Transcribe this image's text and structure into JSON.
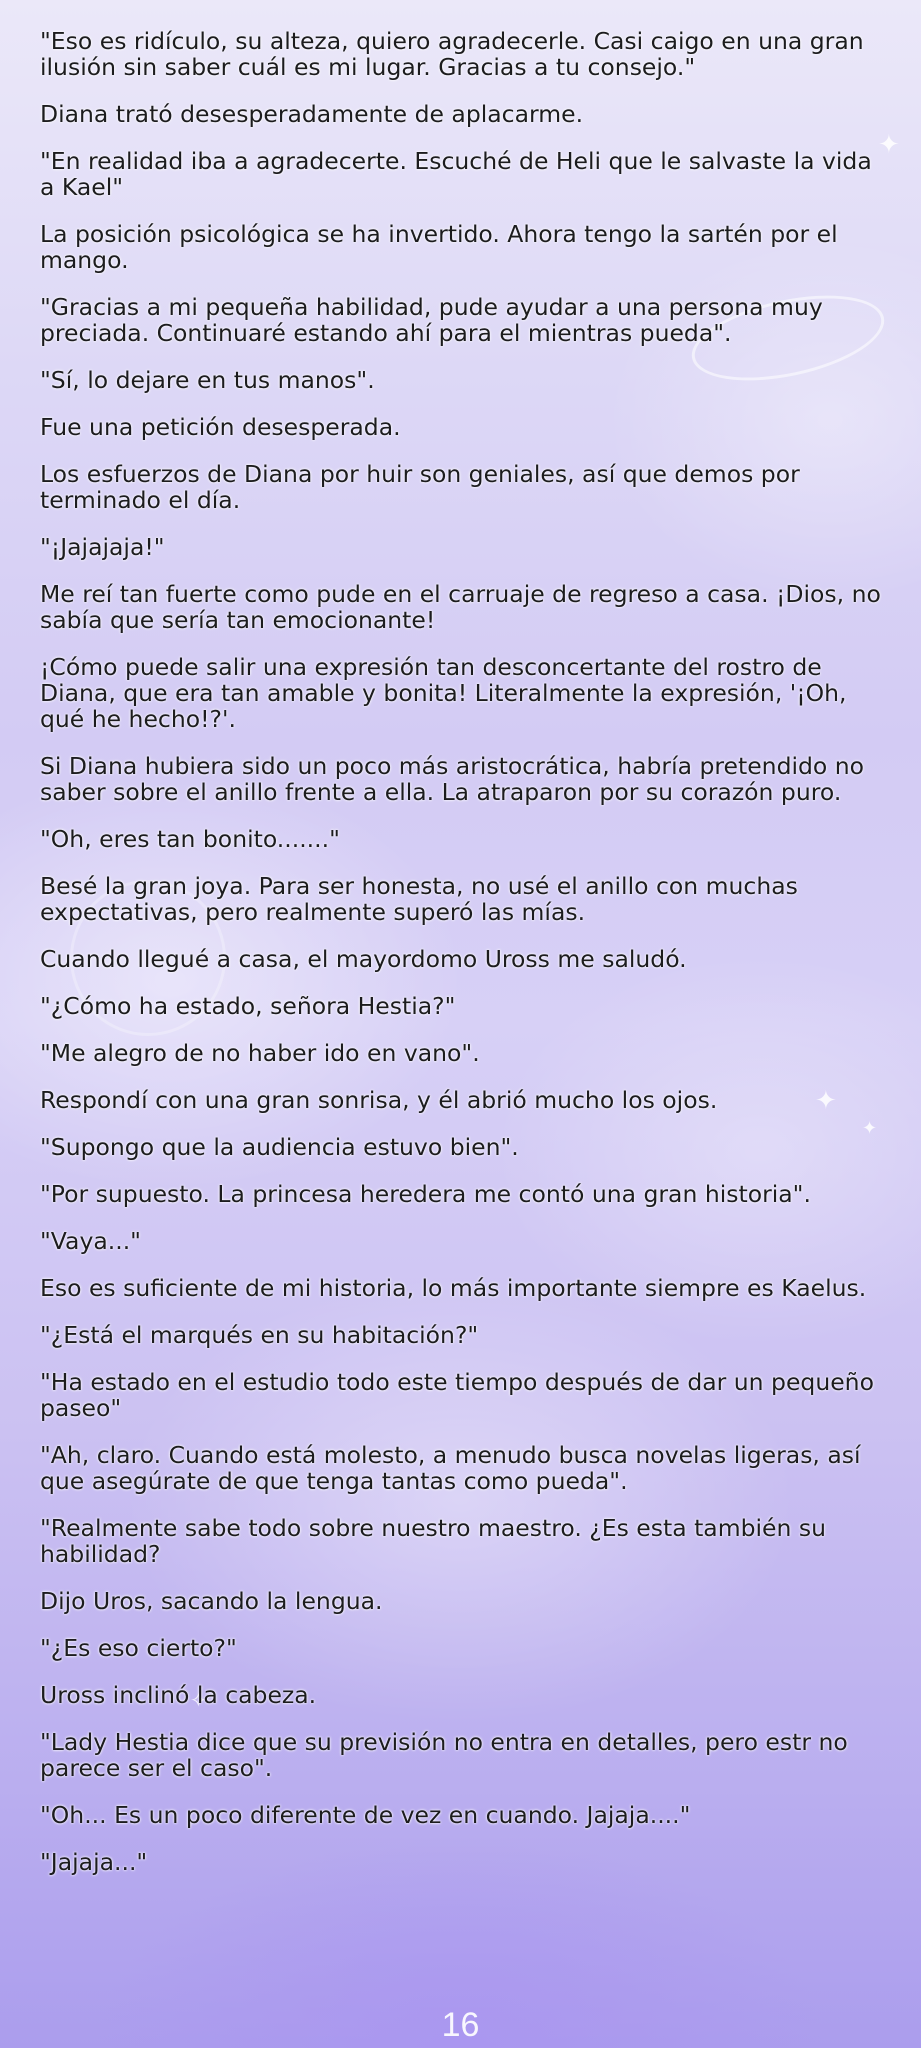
{
  "document": {
    "paragraphs": [
      "\"Eso es ridículo, su alteza, quiero agradecerle. Casi caigo en una gran ilusión sin saber cuál es mi lugar. Gracias a tu consejo.\"",
      "Diana trató desesperadamente de aplacarme.",
      "\"En realidad iba a agradecerte. Escuché de Heli que le salvaste la vida a Kael\"",
      "La posición psicológica se ha invertido. Ahora tengo la sartén por el mango.",
      "\"Gracias a mi pequeña habilidad, pude ayudar a una persona muy preciada. Continuaré estando ahí para el mientras pueda\".",
      "\"Sí, lo dejare en tus manos\".",
      "Fue una petición desesperada.",
      "Los esfuerzos de Diana por huir son geniales, así que demos por terminado el día.",
      "\"¡Jajajaja!\"",
      "Me reí tan fuerte como pude en el carruaje de regreso a casa. ¡Dios, no sabía que sería tan emocionante!",
      "¡Cómo puede salir una expresión tan desconcertante del rostro de Diana, que era tan amable y bonita! Literalmente la expresión, '¡Oh, qué he hecho!?'.",
      "Si Diana hubiera sido un poco más aristocrática, habría pretendido no saber sobre el anillo frente a ella. La atraparon por su corazón puro.",
      "\"Oh, eres tan bonito.......\"",
      "Besé la gran joya. Para ser honesta, no usé el anillo con muchas expectativas, pero realmente superó las mías.",
      "Cuando llegué a casa, el mayordomo Uross me saludó.",
      "\"¿Cómo ha estado, señora Hestia?\"",
      "\"Me alegro de no haber ido en vano\".",
      "Respondí con una gran sonrisa, y él abrió mucho los ojos.",
      "\"Supongo que la audiencia estuvo bien\".",
      "\"Por supuesto. La princesa heredera me contó una gran historia\".",
      "\"Vaya...\"",
      "Eso es suficiente de mi historia, lo más importante siempre es Kaelus.",
      "\"¿Está el marqués en su habitación?\"",
      "\"Ha estado en el estudio todo este tiempo después de dar un pequeño paseo\"",
      "\"Ah, claro. Cuando está molesto, a menudo busca novelas ligeras, así que asegúrate de que tenga tantas como pueda\".",
      "\"Realmente sabe todo sobre nuestro maestro. ¿Es esta también su habilidad?",
      "Dijo Uros, sacando la lengua.",
      "\"¿Es eso cierto?\"",
      "Uross inclinó la cabeza.",
      "\"Lady Hestia dice que su previsión no entra en detalles, pero estr no parece ser el caso\".",
      "\"Oh... Es un poco diferente de vez en cuando. Jajaja....\"",
      "\"Jajaja...\""
    ],
    "page_number": "16"
  },
  "background": {
    "top_color": "#ebe8f9",
    "bottom_color": "#ab9ded",
    "decoration": "sparkle-icon"
  }
}
